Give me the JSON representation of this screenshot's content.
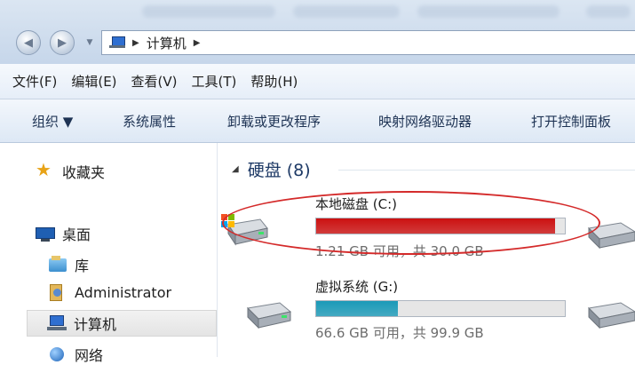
{
  "address": {
    "location": "计算机"
  },
  "menu": [
    "文件(F)",
    "编辑(E)",
    "查看(V)",
    "工具(T)",
    "帮助(H)"
  ],
  "commands": {
    "organize": "组织 ▼",
    "system_properties": "系统属性",
    "uninstall": "卸载或更改程序",
    "map_drive": "映射网络驱动器",
    "control_panel": "打开控制面板"
  },
  "nav": {
    "favorites": "收藏夹",
    "desktop": "桌面",
    "libraries": "库",
    "user": "Administrator",
    "computer": "计算机",
    "network": "网络"
  },
  "group": {
    "title": "硬盘 (8)"
  },
  "drives": [
    {
      "name": "本地磁盘 (C:)",
      "space": "1.21 GB 可用，共 30.0 GB",
      "used_fraction": 0.96,
      "bar_color": "#cc1111"
    },
    {
      "name": "虚拟系统 (G:)",
      "space": "66.6 GB 可用，共 99.9 GB",
      "used_fraction": 0.33,
      "bar_color": "#1b9ab8"
    }
  ],
  "colors": {
    "highlight": "#d42a2a",
    "accent": "#2f6fd1"
  }
}
